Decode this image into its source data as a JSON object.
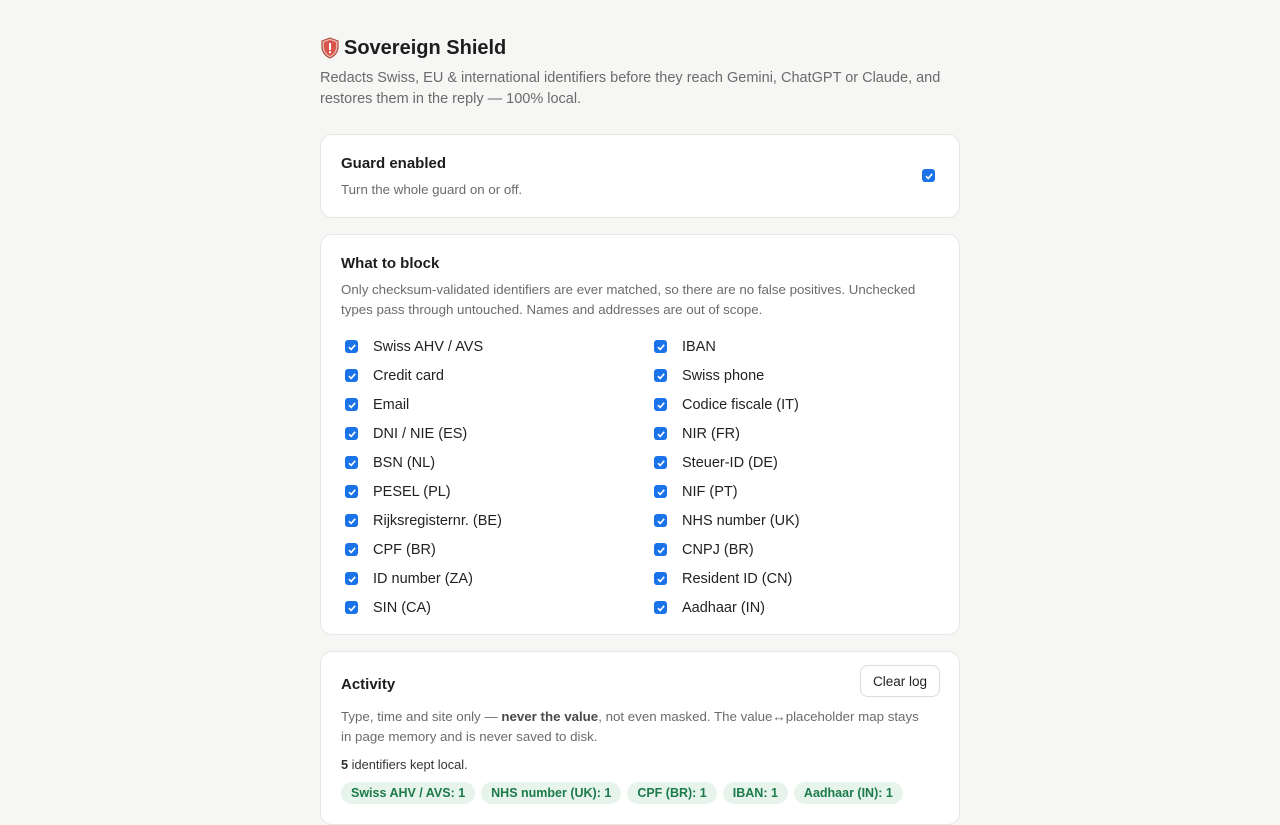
{
  "header": {
    "title": "Sovereign Shield",
    "subtitle_line1": "Redacts Swiss, EU & international identifiers before they reach Gemini, ChatGPT or Claude, and",
    "subtitle_line2": "restores them in the reply — 100% local."
  },
  "guard": {
    "title": "Guard enabled",
    "description": "Turn the whole guard on or off.",
    "checked": true
  },
  "block": {
    "title": "What to block",
    "description_line1": "Only checksum-validated identifiers are ever matched, so there are no false positives. Unchecked",
    "description_line2": "types pass through untouched. Names and addresses are out of scope.",
    "options": [
      {
        "label": "Swiss AHV / AVS",
        "checked": true
      },
      {
        "label": "IBAN",
        "checked": true
      },
      {
        "label": "Credit card",
        "checked": true
      },
      {
        "label": "Swiss phone",
        "checked": true
      },
      {
        "label": "Email",
        "checked": true
      },
      {
        "label": "Codice fiscale (IT)",
        "checked": true
      },
      {
        "label": "DNI / NIE (ES)",
        "checked": true
      },
      {
        "label": "NIR (FR)",
        "checked": true
      },
      {
        "label": "BSN (NL)",
        "checked": true
      },
      {
        "label": "Steuer-ID (DE)",
        "checked": true
      },
      {
        "label": "PESEL (PL)",
        "checked": true
      },
      {
        "label": "NIF (PT)",
        "checked": true
      },
      {
        "label": "Rijksregisternr. (BE)",
        "checked": true
      },
      {
        "label": "NHS number (UK)",
        "checked": true
      },
      {
        "label": "CPF (BR)",
        "checked": true
      },
      {
        "label": "CNPJ (BR)",
        "checked": true
      },
      {
        "label": "ID number (ZA)",
        "checked": true
      },
      {
        "label": "Resident ID (CN)",
        "checked": true
      },
      {
        "label": "SIN (CA)",
        "checked": true
      },
      {
        "label": "Aadhaar (IN)",
        "checked": true
      }
    ]
  },
  "activity": {
    "title": "Activity",
    "clear_label": "Clear log",
    "desc_pre": "Type, time and site only — ",
    "desc_bold": "never the value",
    "desc_post": ", not even masked. The value↔placeholder map stays",
    "desc_line2": "in page memory and is never saved to disk.",
    "count": "5",
    "count_suffix": " identifiers kept local.",
    "chips": [
      "Swiss AHV / AVS: 1",
      "NHS number (UK): 1",
      "CPF (BR): 1",
      "IBAN: 1",
      "Aadhaar (IN): 1"
    ]
  },
  "colors": {
    "accent": "#1a73e8",
    "chip_bg": "#e6f4ec",
    "chip_text": "#1d7a4a"
  }
}
